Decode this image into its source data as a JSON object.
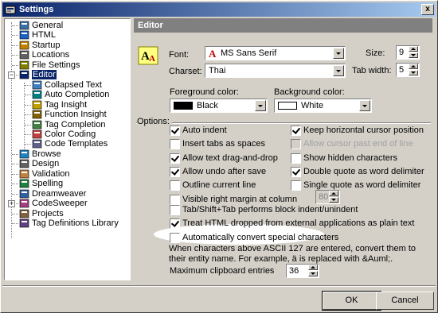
{
  "window": {
    "title": "Settings",
    "close_label": "x"
  },
  "tree": {
    "items": [
      {
        "label": "General",
        "icon": "general-icon"
      },
      {
        "label": "HTML",
        "icon": "html-icon"
      },
      {
        "label": "Startup",
        "icon": "startup-icon"
      },
      {
        "label": "Locations",
        "icon": "locations-icon"
      },
      {
        "label": "File Settings",
        "icon": "file-settings-icon"
      },
      {
        "label": "Editor",
        "icon": "editor-icon",
        "selected": true,
        "expanded": true
      },
      {
        "label": "Collapsed Text",
        "icon": "collapsed-text-icon"
      },
      {
        "label": "Auto Completion",
        "icon": "auto-completion-icon"
      },
      {
        "label": "Tag Insight",
        "icon": "tag-insight-icon"
      },
      {
        "label": "Function Insight",
        "icon": "function-insight-icon"
      },
      {
        "label": "Tag Completion",
        "icon": "tag-completion-icon"
      },
      {
        "label": "Color Coding",
        "icon": "color-coding-icon"
      },
      {
        "label": "Code Templates",
        "icon": "code-templates-icon"
      },
      {
        "label": "Browse",
        "icon": "browse-icon"
      },
      {
        "label": "Design",
        "icon": "design-icon"
      },
      {
        "label": "Validation",
        "icon": "validation-icon"
      },
      {
        "label": "Spelling",
        "icon": "spelling-icon"
      },
      {
        "label": "Dreamweaver",
        "icon": "dreamweaver-icon"
      },
      {
        "label": "CodeSweeper",
        "icon": "codesweeper-icon",
        "expander": "+"
      },
      {
        "label": "Projects",
        "icon": "projects-icon"
      },
      {
        "label": "Tag Definitions Library",
        "icon": "tag-definitions-icon"
      }
    ]
  },
  "panel": {
    "header": "Editor",
    "font": {
      "label": "Font:",
      "value": "MS Sans Serif"
    },
    "size": {
      "label": "Size:",
      "value": "9"
    },
    "charset": {
      "label": "Charset:",
      "value": "Thai"
    },
    "tab_width": {
      "label": "Tab width:",
      "value": "5"
    },
    "foreground": {
      "label": "Foreground color:",
      "value": "Black",
      "color": "#000000"
    },
    "background": {
      "label": "Background color:",
      "value": "White",
      "color": "#ffffff"
    },
    "options_label": "Options:",
    "options_left": [
      {
        "label": "Auto indent",
        "checked": true
      },
      {
        "label": "Insert tabs as spaces",
        "checked": false
      },
      {
        "label": "Allow text drag-and-drop",
        "checked": true
      },
      {
        "label": "Allow undo after save",
        "checked": true
      },
      {
        "label": "Outline current line",
        "checked": false
      },
      {
        "label": "Visible right margin at column",
        "checked": false
      }
    ],
    "options_right": [
      {
        "label": "Keep horizontal cursor position",
        "checked": true
      },
      {
        "label": "Allow cursor past end of line",
        "checked": false,
        "disabled": true
      },
      {
        "label": "Show hidden characters",
        "checked": false
      },
      {
        "label": "Double quote as word delimiter",
        "checked": true
      },
      {
        "label": "Single quote as word delimiter",
        "checked": false
      }
    ],
    "margin_column": "80",
    "options_wide": [
      {
        "label": "Tab/Shift+Tab performs block indent/unindent",
        "checked": false
      },
      {
        "label": "Treat HTML dropped from external applications as plain text",
        "checked": true
      },
      {
        "label": "Automatically convert special characters",
        "checked": false
      }
    ],
    "convert_description": "When characters above ASCII 127 are entered, convert them to their entity name.  For example, ä is replaced with &Auml;.",
    "clipboard": {
      "label": "Maximum clipboard entries",
      "value": "36"
    }
  },
  "buttons": {
    "ok": "OK",
    "cancel": "Cancel"
  }
}
